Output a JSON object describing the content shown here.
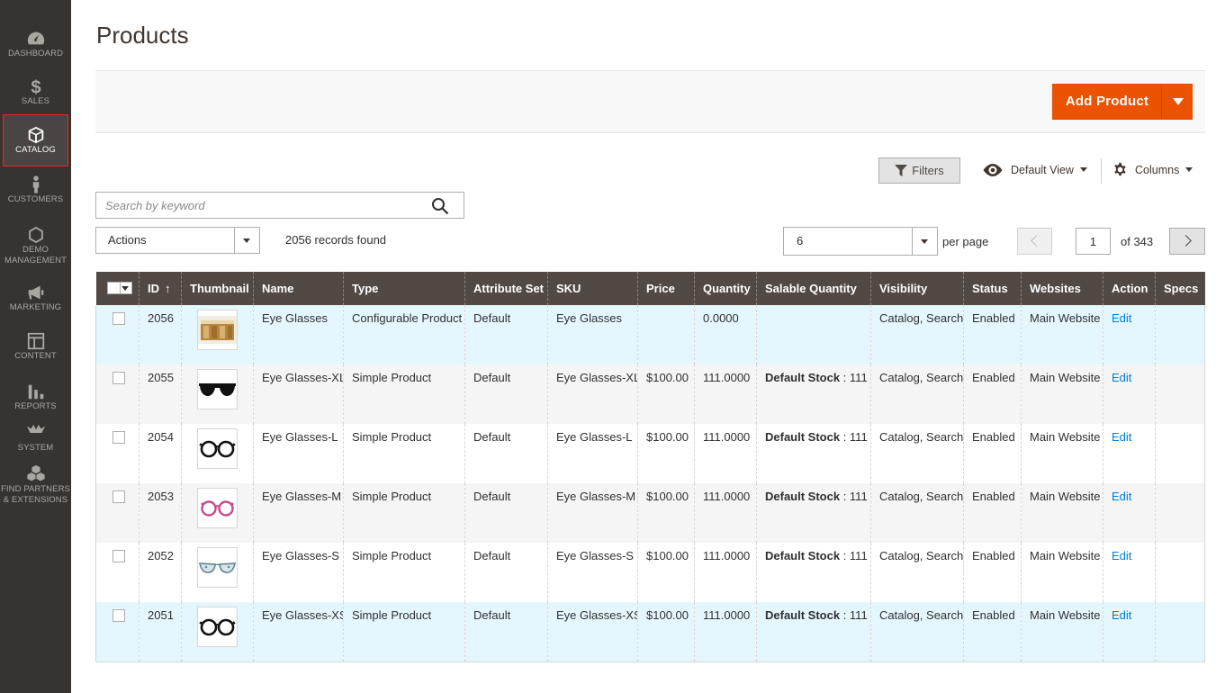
{
  "sidebar": {
    "items": [
      {
        "key": "dashboard",
        "label": "DASHBOARD",
        "icon": "dashboard-icon"
      },
      {
        "key": "sales",
        "label": "SALES",
        "icon": "dollar-icon"
      },
      {
        "key": "catalog",
        "label": "CATALOG",
        "icon": "box-icon",
        "active": true
      },
      {
        "key": "customers",
        "label": "CUSTOMERS",
        "icon": "person-icon"
      },
      {
        "key": "demo",
        "label_line1": "DEMO",
        "label_line2": "MANAGEMENT",
        "icon": "hexagon-icon"
      },
      {
        "key": "marketing",
        "label": "MARKETING",
        "icon": "megaphone-icon"
      },
      {
        "key": "content",
        "label": "CONTENT",
        "icon": "layout-icon"
      },
      {
        "key": "reports",
        "label": "REPORTS",
        "icon": "bar-chart-icon"
      },
      {
        "key": "system",
        "label": "SYSTEM",
        "icon": "system-icon"
      },
      {
        "key": "partners",
        "label_line1": "FIND PARTNERS",
        "label_line2": "& EXTENSIONS",
        "icon": "cubes-icon"
      }
    ]
  },
  "page": {
    "title": "Products"
  },
  "toolbar": {
    "add_product_label": "Add Product",
    "filters_label": "Filters",
    "view_label": "Default View",
    "columns_label": "Columns"
  },
  "search": {
    "placeholder": "Search by keyword",
    "value": ""
  },
  "grid_controls": {
    "actions_label": "Actions",
    "records_found": "2056 records found",
    "per_page_value": "6",
    "per_page_label": "per page",
    "current_page": "1",
    "total_pages_label": "of 343"
  },
  "table": {
    "columns": [
      "ID",
      "Thumbnail",
      "Name",
      "Type",
      "Attribute Set",
      "SKU",
      "Price",
      "Quantity",
      "Salable Quantity",
      "Visibility",
      "Status",
      "Websites",
      "Action",
      "Specs"
    ],
    "sort_arrow": "↑",
    "rows": [
      {
        "id": "2056",
        "thumb": "box",
        "name": "Eye Glasses",
        "type": "Configurable Product",
        "attribute_set": "Default",
        "sku": "Eye Glasses",
        "price": "",
        "quantity": "0.0000",
        "stock_label": "",
        "stock_value": "",
        "visibility": "Catalog, Search",
        "status": "Enabled",
        "websites": "Main Website",
        "action": "Edit"
      },
      {
        "id": "2055",
        "thumb": "sunglasses",
        "name": "Eye Glasses-XL",
        "type": "Simple Product",
        "attribute_set": "Default",
        "sku": "Eye Glasses-XL",
        "price": "$100.00",
        "quantity": "111.0000",
        "stock_label": "Default Stock",
        "stock_value": " : 111",
        "visibility": "Catalog, Search",
        "status": "Enabled",
        "websites": "Main Website",
        "action": "Edit"
      },
      {
        "id": "2054",
        "thumb": "black",
        "name": "Eye Glasses-L",
        "type": "Simple Product",
        "attribute_set": "Default",
        "sku": "Eye Glasses-L",
        "price": "$100.00",
        "quantity": "111.0000",
        "stock_label": "Default Stock",
        "stock_value": " : 111",
        "visibility": "Catalog, Search",
        "status": "Enabled",
        "websites": "Main Website",
        "action": "Edit"
      },
      {
        "id": "2053",
        "thumb": "pink",
        "name": "Eye Glasses-M",
        "type": "Simple Product",
        "attribute_set": "Default",
        "sku": "Eye Glasses-M",
        "price": "$100.00",
        "quantity": "111.0000",
        "stock_label": "Default Stock",
        "stock_value": " : 111",
        "visibility": "Catalog, Search",
        "status": "Enabled",
        "websites": "Main Website",
        "action": "Edit"
      },
      {
        "id": "2052",
        "thumb": "cat",
        "name": "Eye Glasses-S",
        "type": "Simple Product",
        "attribute_set": "Default",
        "sku": "Eye Glasses-S",
        "price": "$100.00",
        "quantity": "111.0000",
        "stock_label": "Default Stock",
        "stock_value": " : 111",
        "visibility": "Catalog, Search",
        "status": "Enabled",
        "websites": "Main Website",
        "action": "Edit"
      },
      {
        "id": "2051",
        "thumb": "black",
        "name": "Eye Glasses-XS",
        "type": "Simple Product",
        "attribute_set": "Default",
        "sku": "Eye Glasses-XS",
        "price": "$100.00",
        "quantity": "111.0000",
        "stock_label": "Default Stock",
        "stock_value": " : 111",
        "visibility": "Catalog, Search",
        "status": "Enabled",
        "websites": "Main Website",
        "action": "Edit"
      }
    ]
  },
  "colors": {
    "sidebar_bg": "#373330",
    "accent_orange": "#eb5202",
    "header_bg": "#514943",
    "link_blue": "#007bdb",
    "active_border": "#e02b27",
    "row_highlight": "#e5f7fe"
  }
}
